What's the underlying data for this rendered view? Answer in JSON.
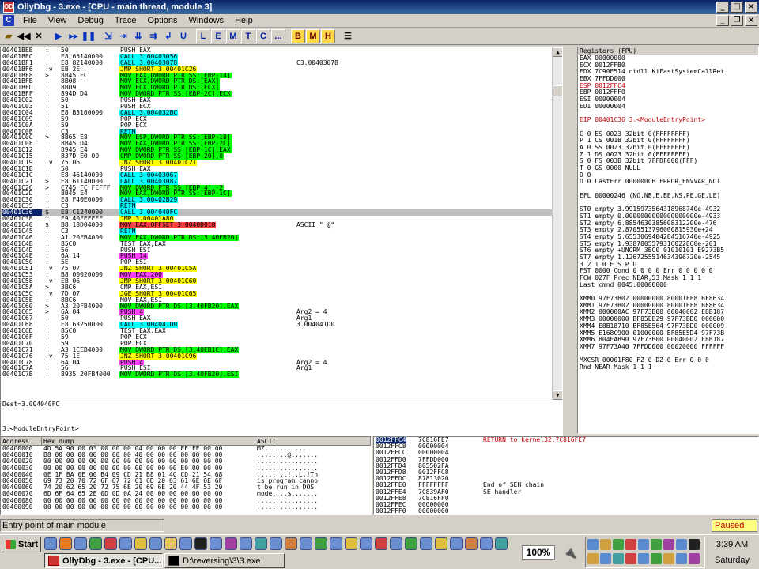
{
  "window": {
    "title": "OllyDbg - 3.exe - [CPU - main thread, module 3]",
    "app_icon": "OD"
  },
  "menu": {
    "icon": "C",
    "items": [
      "File",
      "View",
      "Debug",
      "Trace",
      "Options",
      "Windows",
      "Help"
    ]
  },
  "toolbar": {
    "letters": [
      "L",
      "E",
      "M",
      "T",
      "C",
      "...",
      "B",
      "M",
      "H"
    ]
  },
  "disasm": [
    [
      "00401BEB",
      ":",
      "50",
      "PUSH EAX",
      "",
      ""
    ],
    [
      "00401BEC",
      ".",
      "E8 65140000",
      "CALL 3.00403056",
      "call",
      ""
    ],
    [
      "00401BF1",
      ".",
      "E8 82140000",
      "CALL 3.00403078",
      "call",
      "C3.00403078"
    ],
    [
      "00401BF6",
      ".v",
      "EB 2E",
      "JMP SHORT 3.00401C26",
      "jmp",
      ""
    ],
    [
      "00401BF8",
      ">",
      "8B45 EC",
      "MOV EAX,DWORD PTR SS:[EBP-14]",
      "mem",
      ""
    ],
    [
      "00401BFB",
      ".",
      "8B08",
      "MOV ECX,DWORD PTR DS:[EAX]",
      "mem",
      ""
    ],
    [
      "00401BFD",
      ".",
      "8B09",
      "MOV ECX,DWORD PTR DS:[ECX]",
      "mem",
      ""
    ],
    [
      "00401BFF",
      ".",
      "894D D4",
      "MOV DWORD PTR SS:[EBP-2C],ECX",
      "mem",
      ""
    ],
    [
      "00401C02",
      ".",
      "50",
      "PUSH EAX",
      "",
      ""
    ],
    [
      "00401C03",
      ".",
      "51",
      "PUSH ECX",
      "",
      ""
    ],
    [
      "00401C04",
      ".",
      "E8 B3160000",
      "CALL 3.004032BC",
      "call",
      ""
    ],
    [
      "00401C09",
      ".",
      "59",
      "POP ECX",
      "",
      ""
    ],
    [
      "00401C0A",
      ".",
      "59",
      "POP ECX",
      "",
      ""
    ],
    [
      "00401C0B",
      ".",
      "C3",
      "RETN",
      "ret",
      ""
    ],
    [
      "00401C0C",
      ">",
      "8B65 E8",
      "MOV ESP,DWORD PTR SS:[EBP-18]",
      "mem",
      ""
    ],
    [
      "00401C0F",
      ".",
      "8B45 D4",
      "MOV EAX,DWORD PTR SS:[EBP-2C]",
      "mem",
      ""
    ],
    [
      "00401C12",
      ".",
      "8945 E4",
      "MOV DWORD PTR SS:[EBP-1C],EAX",
      "mem",
      ""
    ],
    [
      "00401C15",
      ".",
      "837D E0 00",
      "CMP DWORD PTR SS:[EBP-20],0",
      "mem",
      ""
    ],
    [
      "00401C19",
      ".v",
      "75 06",
      "JNZ SHORT 3.00401C21",
      "jmp",
      ""
    ],
    [
      "00401C1B",
      ".",
      "50",
      "PUSH EAX",
      "",
      ""
    ],
    [
      "00401C1C",
      ".",
      "E8 46140000",
      "CALL 3.00403067",
      "call",
      ""
    ],
    [
      "00401C21",
      ">",
      "E8 61140000",
      "CALL 3.00403087",
      "call",
      ""
    ],
    [
      "00401C26",
      ">",
      "C745 FC FEFFF",
      "MOV DWORD PTR SS:[EBP-4],-2",
      "mem",
      ""
    ],
    [
      "00401C2D",
      ".",
      "8B45 E4",
      "MOV EAX,DWORD PTR SS:[EBP-1C]",
      "mem",
      ""
    ],
    [
      "00401C30",
      ".",
      "E8 F40E0000",
      "CALL 3.00402B29",
      "call",
      ""
    ],
    [
      "00401C35",
      ".",
      "C3",
      "RETN",
      "ret",
      ""
    ],
    [
      "00401C36",
      "$",
      "E8 C1240000",
      "CALL 3.004040FC",
      "call",
      ""
    ],
    [
      "00401C3B",
      "^",
      "E9 40FEFFFF",
      "JMP 3.00401A80",
      "jmp",
      ""
    ],
    [
      "00401C40",
      "$",
      "B8 18D04000",
      "MOV EAX,OFFSET 3.0040D018",
      "off",
      "ASCII \" @\""
    ],
    [
      "00401C45",
      ".",
      "C3",
      "RETN",
      "ret",
      ""
    ],
    [
      "00401C46",
      ".",
      "A1 20FB4000",
      "MOV EAX,DWORD PTR DS:[3.40FB20]",
      "mem",
      ""
    ],
    [
      "00401C4B",
      ".",
      "85C0",
      "TEST EAX,EAX",
      "",
      ""
    ],
    [
      "00401C4D",
      ".",
      "56",
      "PUSH ESI",
      "",
      ""
    ],
    [
      "00401C4E",
      ".",
      "6A 14",
      "PUSH 14",
      "imm",
      ""
    ],
    [
      "00401C50",
      ".",
      "5E",
      "POP ESI",
      "",
      ""
    ],
    [
      "00401C51",
      ".v",
      "75 07",
      "JNZ SHORT 3.00401C5A",
      "jmp",
      ""
    ],
    [
      "00401C53",
      ".",
      "B8 00020000",
      "MOV EAX,200",
      "imm",
      ""
    ],
    [
      "00401C58",
      ".v",
      "EB 06",
      "JMP SHORT 3.00401C60",
      "jmp",
      ""
    ],
    [
      "00401C5A",
      ">",
      "3BC6",
      "CMP EAX,ESI",
      "",
      ""
    ],
    [
      "00401C5C",
      ".v",
      "7D 07",
      "JGE SHORT 3.00401C65",
      "jmp",
      ""
    ],
    [
      "00401C5E",
      ".",
      "8BC6",
      "MOV EAX,ESI",
      "",
      ""
    ],
    [
      "00401C60",
      ">",
      "A3 20FB4000",
      "MOV DWORD PTR DS:[3.40FB20],EAX",
      "mem",
      ""
    ],
    [
      "00401C65",
      ">",
      "6A 04",
      "PUSH 4",
      "imm",
      "Arg2 = 4"
    ],
    [
      "00401C67",
      ".",
      "50",
      "PUSH EAX",
      "",
      "Arg1"
    ],
    [
      "00401C68",
      ".",
      "E8 63250000",
      "CALL 3.004041D0",
      "call",
      "3.004041D0"
    ],
    [
      "00401C6D",
      ".",
      "85C0",
      "TEST EAX,EAX",
      "",
      ""
    ],
    [
      "00401C6F",
      ".",
      "59",
      "POP ECX",
      "",
      ""
    ],
    [
      "00401C70",
      ".",
      "59",
      "POP ECX",
      "",
      ""
    ],
    [
      "00401C71",
      ".",
      "A3 1CEB4000",
      "MOV DWORD PTR DS:[3.40EB1C],EAX",
      "mem",
      ""
    ],
    [
      "00401C76",
      ".v",
      "75 1E",
      "JNZ SHORT 3.00401C96",
      "jmp",
      ""
    ],
    [
      "00401C78",
      ".",
      "6A 04",
      "PUSH 4",
      "imm",
      "Arg2 = 4"
    ],
    [
      "00401C7A",
      ".",
      "56",
      "PUSH ESI",
      "",
      "Arg1"
    ],
    [
      "00401C7B",
      ".",
      "8935 20FB4000",
      "MOV DWORD PTR DS:[3.40FB20],ESI",
      "mem",
      ""
    ]
  ],
  "info": {
    "line1": "Dest=3.004040FC",
    "line2": "3.<ModuleEntryPoint>"
  },
  "registers": {
    "header": "Registers (FPU)",
    "lines": [
      [
        "EAX 00000000",
        ""
      ],
      [
        "ECX 0012FFB0",
        ""
      ],
      [
        "EDX 7C90E514 ntdll.KiFastSystemCallRet",
        ""
      ],
      [
        "EBX 7FFDD000",
        ""
      ],
      [
        "ESP 0012FFC4",
        "r"
      ],
      [
        "EBP 0012FFF0",
        ""
      ],
      [
        "ESI 00000004",
        ""
      ],
      [
        "EDI 00000004",
        ""
      ],
      [
        "",
        ""
      ],
      [
        "EIP 00401C36 3.<ModuleEntryPoint>",
        "r"
      ],
      [
        "",
        ""
      ],
      [
        "C 0   ES 0023 32bit 0(FFFFFFFF)",
        ""
      ],
      [
        "P 1   CS 001B 32bit 0(FFFFFFFF)",
        ""
      ],
      [
        "A 0   SS 0023 32bit 0(FFFFFFFF)",
        ""
      ],
      [
        "Z 1   DS 0023 32bit 0(FFFFFFFF)",
        ""
      ],
      [
        "S 0   FS 003B 32bit 7FFDF000(FFF)",
        ""
      ],
      [
        "T 0   GS 0000 NULL",
        ""
      ],
      [
        "D 0",
        ""
      ],
      [
        "O 0   LastErr 000000CB ERROR_ENVVAR_NOT",
        ""
      ],
      [
        "",
        ""
      ],
      [
        "EFL 00000246 (NO,NB,E,BE,NS,PE,GE,LE)",
        ""
      ],
      [
        "",
        ""
      ],
      [
        "ST0 empty 3.9915973564318968740e-4932",
        ""
      ],
      [
        "ST1 empty 0.0000000000000000000e-4933",
        ""
      ],
      [
        "ST2 empty 6.8854630385608312200e-476",
        ""
      ],
      [
        "ST3 empty 2.8705513796000815930e+24",
        ""
      ],
      [
        "ST4 empty 5.6553069404284516740e-4925",
        ""
      ],
      [
        "ST5 empty 1.9387805579316022860e-201",
        ""
      ],
      [
        "ST6 empty +UNORM 3BC0 01010101 E9273B5",
        ""
      ],
      [
        "ST7 empty 1.1267255514634396720e-2545",
        ""
      ],
      [
        "               3 2 1 0      E S P U",
        ""
      ],
      [
        "FST 0000  Cond 0 0 0 0  Err 0 0 0 0 0",
        ""
      ],
      [
        "FCW 027F  Prec NEAR,53  Mask   1 1 1",
        ""
      ],
      [
        "Last cmnd 0045:00000000",
        ""
      ],
      [
        "",
        ""
      ],
      [
        "XMM0 97F73B02 00000000 80001EF8 BF8634",
        ""
      ],
      [
        "XMM1 97F73B02 00000000 80001EF8 BF8634",
        ""
      ],
      [
        "XMM2 000000AC 97F73B00 00040002 E8B187",
        ""
      ],
      [
        "XMM3 00000000 BF85EE29 97F73BD0 000000",
        ""
      ],
      [
        "XMM4 E8B18710 BF85E564 97F73BD0 000009",
        ""
      ],
      [
        "XMM5 E168C900 01000000 BF85E5D4 97F73B",
        ""
      ],
      [
        "XMM6 804EAB90 97F73B00 00040002 E8B187",
        ""
      ],
      [
        "XMM7 97F73A40 7FFDD000 00020000 FFFFFF",
        ""
      ],
      [
        "",
        ""
      ],
      [
        "MXCSR 00001F80  FZ 0 DZ 0  Err  0 0 0",
        ""
      ],
      [
        "                Rnd NEAR   Mask  1 1 1",
        ""
      ]
    ]
  },
  "dump": {
    "headers": [
      "Address",
      "Hex dump",
      "ASCII"
    ],
    "rows": [
      [
        "00400000",
        "4D 5A 90 00 03 00 00 00 04 00 00 00 FF FF 00 00",
        "MZ..........."
      ],
      [
        "00400010",
        "B8 00 00 00 00 00 00 00 40 00 00 00 00 00 00 00",
        "........@......."
      ],
      [
        "00400020",
        "00 00 00 00 00 00 00 00 00 00 00 00 00 00 00 00",
        "................"
      ],
      [
        "00400030",
        "00 00 00 00 00 00 00 00 00 00 00 00 E0 00 00 00",
        "................"
      ],
      [
        "00400040",
        "0E 1F BA 0E 00 B4 09 CD 21 B8 01 4C CD 21 54 68",
        "........!..L.!Th"
      ],
      [
        "00400050",
        "69 73 20 70 72 6F 67 72 61 6D 20 63 61 6E 6E 6F",
        "is program canno"
      ],
      [
        "00400060",
        "74 20 62 65 20 72 75 6E 20 69 6E 20 44 4F 53 20",
        "t be run in DOS "
      ],
      [
        "00400070",
        "6D 6F 64 65 2E 0D 0D 0A 24 00 00 00 00 00 00 00",
        "mode....$......."
      ],
      [
        "00400080",
        "00 00 00 00 00 00 00 00 00 00 00 00 00 00 00 00",
        "................"
      ],
      [
        "00400090",
        "00 00 00 00 00 00 00 00 00 00 00 00 00 00 00 00",
        "................"
      ]
    ]
  },
  "stack": {
    "rows": [
      [
        "0012FFC4",
        "7C816FE7",
        "RETURN to kernel32.7C816FE7"
      ],
      [
        "0012FFC8",
        "00000004",
        ""
      ],
      [
        "0012FFCC",
        "00000004",
        ""
      ],
      [
        "0012FFD0",
        "7FFDD000",
        ""
      ],
      [
        "0012FFD4",
        "805502FA",
        ""
      ],
      [
        "0012FFD8",
        "0012FFC8",
        ""
      ],
      [
        "0012FFDC",
        "87813020",
        ""
      ],
      [
        "0012FFE0",
        "FFFFFFFF",
        "End of SEH chain"
      ],
      [
        "0012FFE4",
        "7C839AF0",
        "SE handler"
      ],
      [
        "0012FFE8",
        "7C816FF0",
        ""
      ],
      [
        "0012FFEC",
        "00000000",
        ""
      ],
      [
        "0012FFF0",
        "00000000",
        ""
      ]
    ]
  },
  "status": {
    "text": "Entry point of main module",
    "state": "Paused"
  },
  "taskbar": {
    "start": "Start",
    "tasks": [
      "OllyDbg - 3.exe - [CPU...",
      "D:\\reversing\\3\\3.exe"
    ],
    "battery": "100%",
    "time": "3:39 AM",
    "day": "Saturday"
  }
}
